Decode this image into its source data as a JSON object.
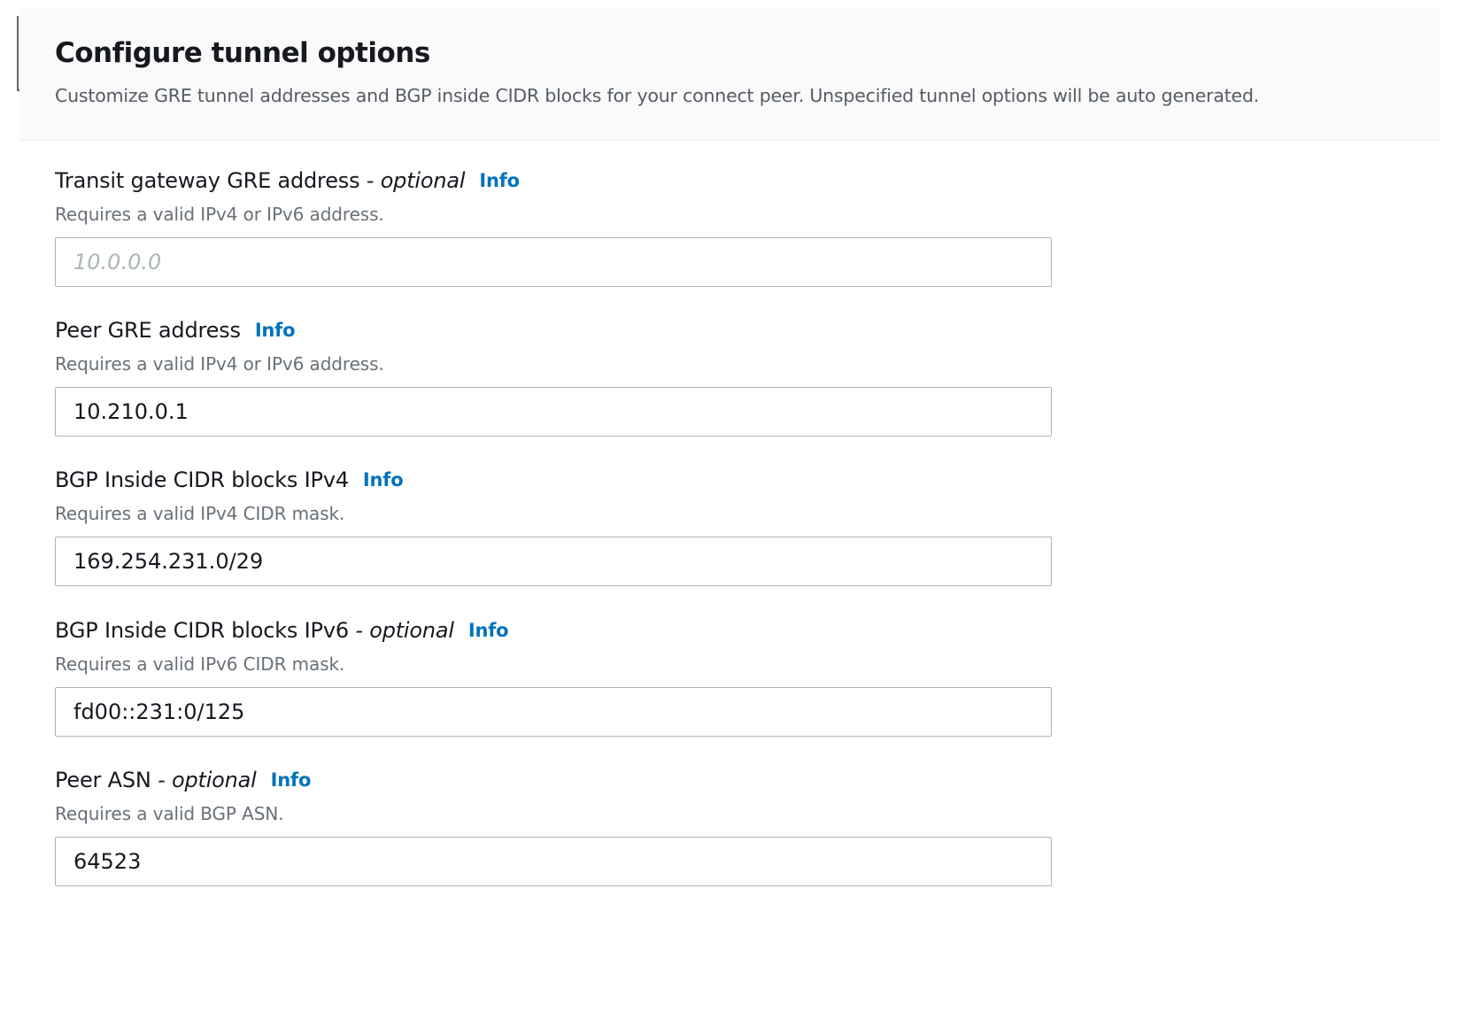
{
  "panel": {
    "title": "Configure tunnel options",
    "description": "Customize GRE tunnel addresses and BGP inside CIDR blocks for your connect peer. Unspecified tunnel options will be auto generated."
  },
  "fields": [
    {
      "label": "Transit gateway GRE address",
      "optional_text": " - optional",
      "info": "Info",
      "hint": "Requires a valid IPv4 or IPv6 address.",
      "value": "",
      "placeholder": "10.0.0.0"
    },
    {
      "label": "Peer GRE address",
      "optional_text": "",
      "info": "Info",
      "hint": "Requires a valid IPv4 or IPv6 address.",
      "value": "10.210.0.1",
      "placeholder": ""
    },
    {
      "label": "BGP Inside CIDR blocks IPv4",
      "optional_text": "",
      "info": "Info",
      "hint": "Requires a valid IPv4 CIDR mask.",
      "value": "169.254.231.0/29",
      "placeholder": ""
    },
    {
      "label": "BGP Inside CIDR blocks IPv6",
      "optional_text": " - optional",
      "info": "Info",
      "hint": "Requires a valid IPv6 CIDR mask.",
      "value": "fd00::231:0/125",
      "placeholder": ""
    },
    {
      "label": "Peer ASN",
      "optional_text": " - optional",
      "info": "Info",
      "hint": "Requires a valid BGP ASN.",
      "value": "64523",
      "placeholder": ""
    }
  ],
  "colors": {
    "info_link": "#0073bb",
    "hint_text": "#687078",
    "input_border": "#aab7b8",
    "header_background": "#fafafa"
  }
}
